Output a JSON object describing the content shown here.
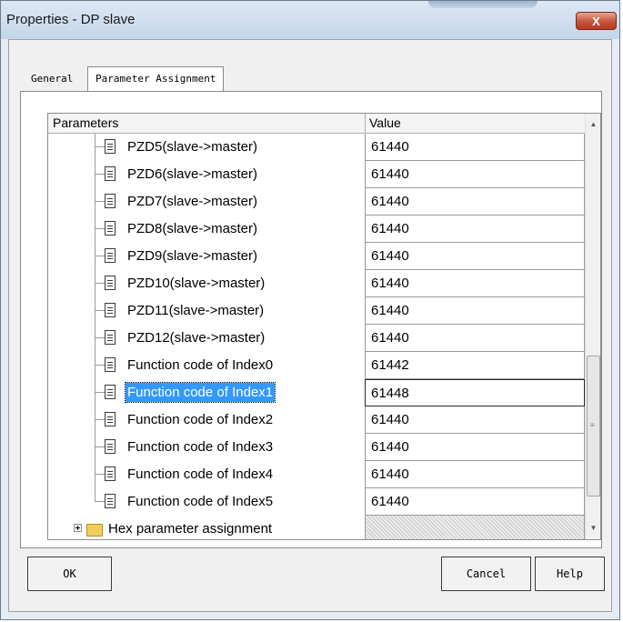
{
  "window": {
    "title": "Properties - DP slave",
    "close_glyph": "X"
  },
  "tabs": [
    {
      "label": "General",
      "selected": false
    },
    {
      "label": "Parameter Assignment",
      "selected": true
    }
  ],
  "grid": {
    "col_parameters": "Parameters",
    "col_value": "Value",
    "rows": [
      {
        "name": "PZD5(slave->master)",
        "value": "61440",
        "selected": false
      },
      {
        "name": "PZD6(slave->master)",
        "value": "61440",
        "selected": false
      },
      {
        "name": "PZD7(slave->master)",
        "value": "61440",
        "selected": false
      },
      {
        "name": "PZD8(slave->master)",
        "value": "61440",
        "selected": false
      },
      {
        "name": "PZD9(slave->master)",
        "value": "61440",
        "selected": false
      },
      {
        "name": "PZD10(slave->master)",
        "value": "61440",
        "selected": false
      },
      {
        "name": "PZD11(slave->master)",
        "value": "61440",
        "selected": false
      },
      {
        "name": "PZD12(slave->master)",
        "value": "61440",
        "selected": false
      },
      {
        "name": "Function code of Index0",
        "value": "61442",
        "selected": false
      },
      {
        "name": "Function code of Index1",
        "value": "61448",
        "selected": true
      },
      {
        "name": "Function code of Index2",
        "value": "61440",
        "selected": false
      },
      {
        "name": "Function code of Index3",
        "value": "61440",
        "selected": false
      },
      {
        "name": "Function code of Index4",
        "value": "61440",
        "selected": false
      },
      {
        "name": "Function code of Index5",
        "value": "61440",
        "selected": false
      }
    ],
    "folder_row": {
      "name": "Hex parameter assignment"
    }
  },
  "buttons": {
    "ok": "OK",
    "cancel": "Cancel",
    "help": "Help"
  },
  "colors": {
    "selection": "#3399ff",
    "close_button": "#c8533c"
  }
}
